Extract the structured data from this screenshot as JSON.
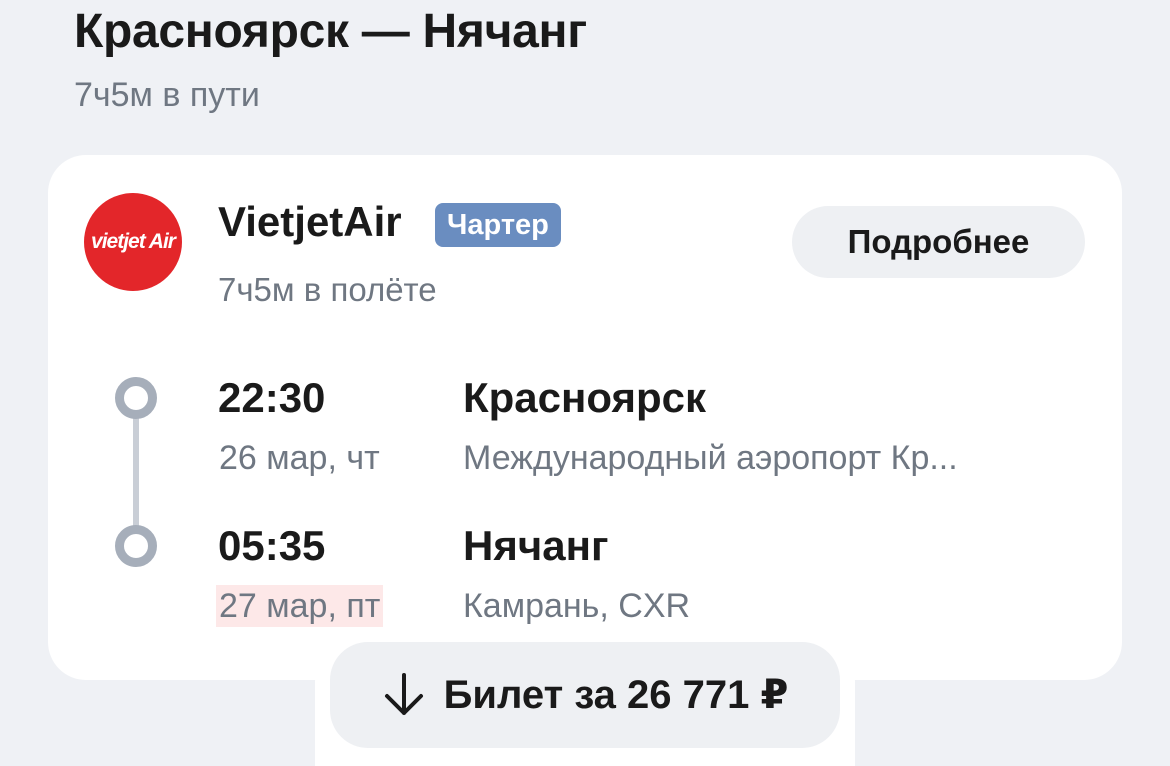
{
  "route": {
    "title": "Красноярск — Нячанг",
    "total_duration": "7ч5м в пути"
  },
  "flight": {
    "airline_logo_text": "vietjet Air",
    "airline_name": "VietjetAir",
    "badge": "Чартер",
    "flight_duration": "7ч5м в полёте",
    "details_label": "Подробнее",
    "departure": {
      "time": "22:30",
      "date": "26 мар, чт",
      "city": "Красноярск",
      "airport": "Международный аэропорт Кр..."
    },
    "arrival": {
      "time": "05:35",
      "date": "27 мар, пт",
      "city": "Нячанг",
      "airport": "Камрань, CXR"
    }
  },
  "ticket": {
    "label": "Билет за 26 771 ₽",
    "icon": "arrow-down-icon"
  },
  "colors": {
    "background": "#eff1f5",
    "logo": "#e3262a",
    "badge": "#6a8dc0",
    "next_day_highlight": "#fde8e8",
    "button": "#eef0f3"
  }
}
